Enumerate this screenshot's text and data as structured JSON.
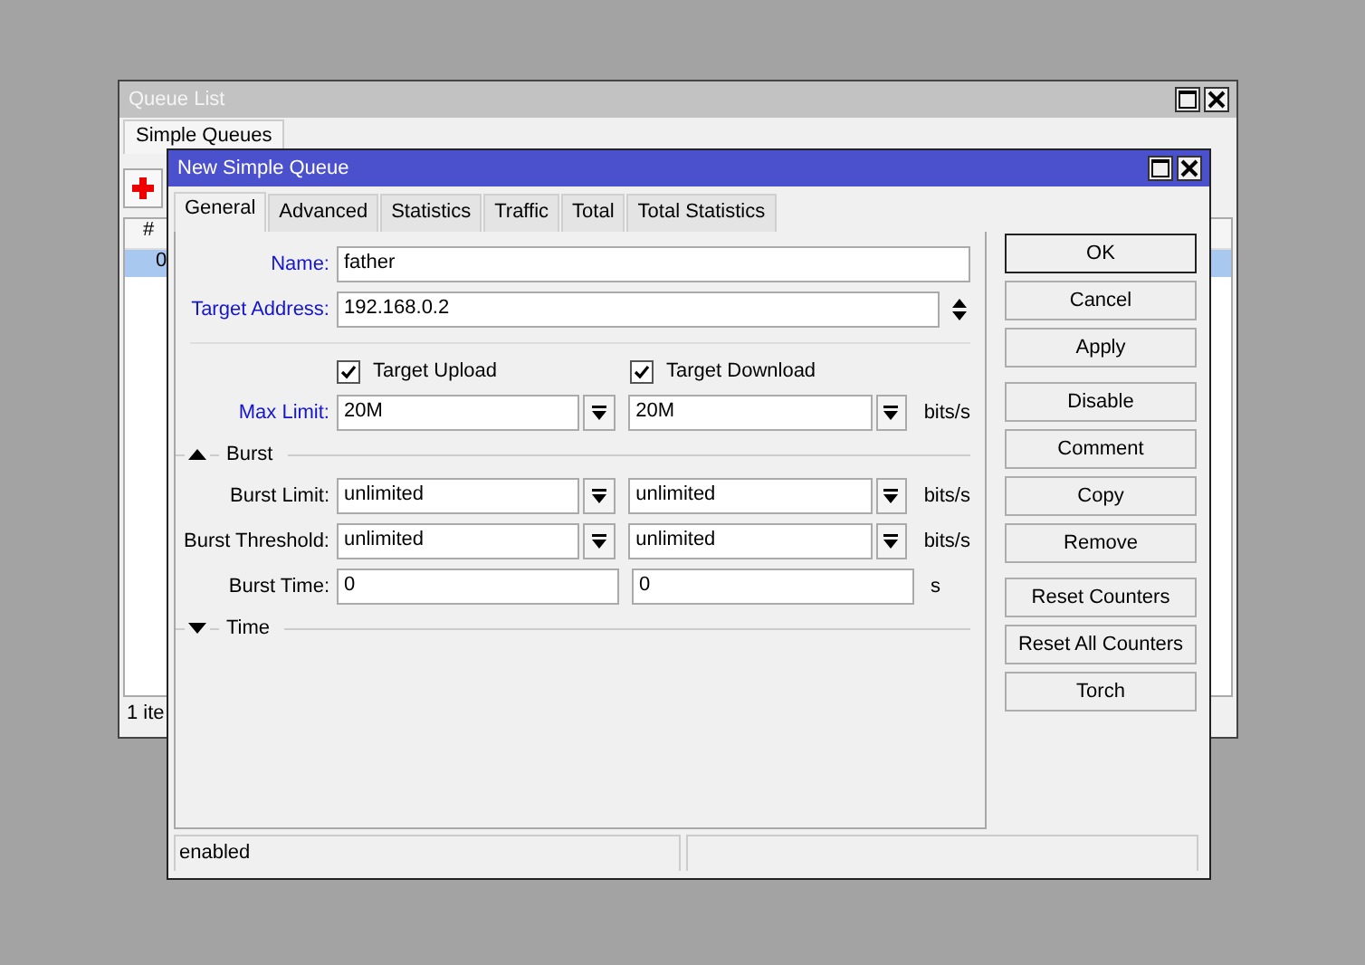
{
  "background_window": {
    "title": "Queue List",
    "tabs": [
      {
        "label": "Simple Queues"
      }
    ],
    "column_header": "#",
    "rows": [
      {
        "number": "0",
        "selected": true
      }
    ],
    "status": "1 ite"
  },
  "dialog": {
    "title": "New Simple Queue",
    "tabs": [
      {
        "label": "General",
        "selected": true
      },
      {
        "label": "Advanced",
        "selected": false
      },
      {
        "label": "Statistics",
        "selected": false
      },
      {
        "label": "Traffic",
        "selected": false
      },
      {
        "label": "Total",
        "selected": false
      },
      {
        "label": "Total Statistics",
        "selected": false
      }
    ],
    "rows": [
      {
        "kind": "text",
        "label": "Name:",
        "value": "father",
        "required": true
      },
      {
        "kind": "address",
        "label": "Target Address:",
        "value": "192.168.0.2",
        "required": true
      },
      {
        "kind": "divider"
      },
      {
        "kind": "checks",
        "items": [
          {
            "label": "Target Upload",
            "checked": true
          },
          {
            "label": "Target Download",
            "checked": true
          }
        ]
      },
      {
        "kind": "pair",
        "label": "Max Limit:",
        "values": [
          "20M",
          "20M"
        ],
        "dropdown": true,
        "unit": "bits/s",
        "required": true
      },
      {
        "kind": "section",
        "label": "Burst",
        "expanded": true
      },
      {
        "kind": "pair",
        "label": "Burst Limit:",
        "values": [
          "unlimited",
          "unlimited"
        ],
        "dropdown": true,
        "unit": "bits/s",
        "required": false
      },
      {
        "kind": "pair",
        "label": "Burst Threshold:",
        "values": [
          "unlimited",
          "unlimited"
        ],
        "dropdown": true,
        "unit": "bits/s",
        "required": false
      },
      {
        "kind": "pair",
        "label": "Burst Time:",
        "values": [
          "0",
          "0"
        ],
        "dropdown": false,
        "unit": "s",
        "required": false
      },
      {
        "kind": "section",
        "label": "Time",
        "expanded": false
      }
    ],
    "button_groups": [
      [
        {
          "label": "OK",
          "default": true
        },
        {
          "label": "Cancel",
          "default": false
        },
        {
          "label": "Apply",
          "default": false
        }
      ],
      [
        {
          "label": "Disable",
          "default": false
        },
        {
          "label": "Comment",
          "default": false
        },
        {
          "label": "Copy",
          "default": false
        },
        {
          "label": "Remove",
          "default": false
        }
      ],
      [
        {
          "label": "Reset Counters",
          "default": false
        },
        {
          "label": "Reset All Counters",
          "default": false
        },
        {
          "label": "Torch",
          "default": false
        }
      ]
    ],
    "status_bar": {
      "text": "enabled"
    }
  }
}
